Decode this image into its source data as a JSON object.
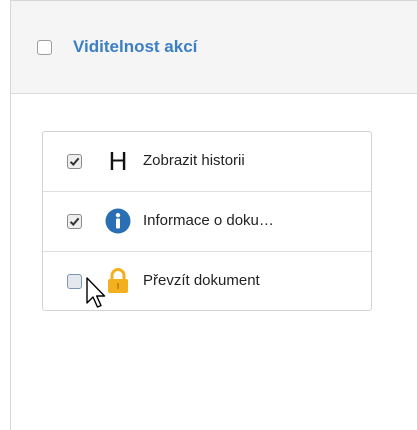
{
  "header": {
    "title": "Viditelnost akcí",
    "checkbox_checked": false
  },
  "items": [
    {
      "label": "Zobrazit historii",
      "checked": true,
      "icon": "history-h-icon",
      "icon_glyph": "H"
    },
    {
      "label": "Informace o doku…",
      "checked": true,
      "icon": "info-icon"
    },
    {
      "label": "Převzít dokument",
      "checked": false,
      "icon": "lock-icon"
    }
  ],
  "colors": {
    "title": "#3b7fc4",
    "info_icon": "#2a6eb3",
    "lock_icon": "#f2b01e"
  }
}
